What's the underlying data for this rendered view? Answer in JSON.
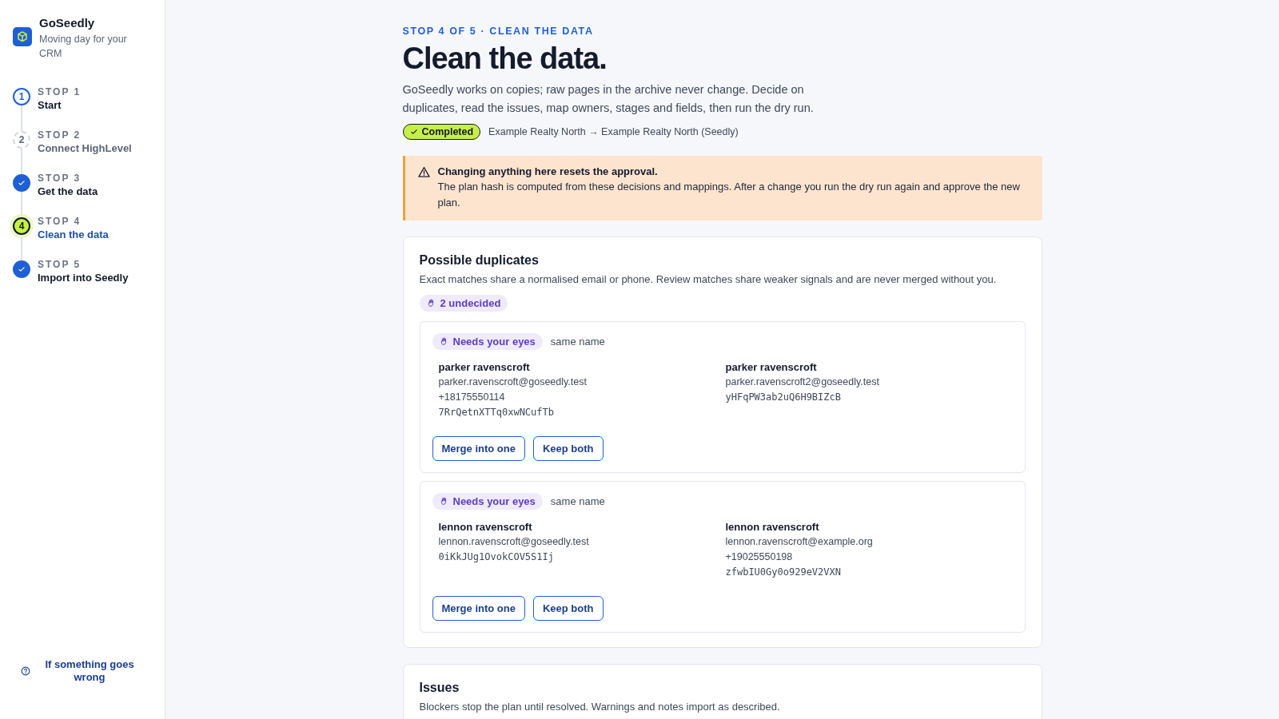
{
  "brand": {
    "name": "GoSeedly",
    "tagline": "Moving day for your CRM"
  },
  "steps": [
    {
      "label": "STOP 1",
      "title": "Start",
      "kind": "open",
      "number": "1"
    },
    {
      "label": "STOP 2",
      "title": "Connect HighLevel",
      "kind": "locked",
      "number": "2"
    },
    {
      "label": "STOP 3",
      "title": "Get the data",
      "kind": "done"
    },
    {
      "label": "STOP 4",
      "title": "Clean the data",
      "kind": "active",
      "number": "4"
    },
    {
      "label": "STOP 5",
      "title": "Import into Seedly",
      "kind": "done"
    }
  ],
  "help_link": "If something goes wrong",
  "eyebrow": "STOP 4 OF 5 · CLEAN THE DATA",
  "title": "Clean the data.",
  "intro": "GoSeedly works on copies; raw pages in the archive never change. Decide on duplicates, read the issues, map owners, stages and fields, then run the dry run.",
  "status_badge": "Completed",
  "route": "Example Realty North → Example Realty North (Seedly)",
  "warning": {
    "title": "Changing anything here resets the approval.",
    "text": "The plan hash is computed from these decisions and mappings. After a change you run the dry run again and approve the new plan."
  },
  "duplicates": {
    "title": "Possible duplicates",
    "text": "Exact matches share a normalised email or phone. Review matches share weaker signals and are never merged without you.",
    "count_badge": "2 undecided",
    "pairs": [
      {
        "badge": "Needs your eyes",
        "reason": "same name",
        "records": [
          {
            "name": "parker ravenscroft",
            "lines": [
              {
                "kind": "text",
                "value": "parker.ravenscroft@goseedly.test"
              },
              {
                "kind": "text",
                "value": "+18175550114"
              },
              {
                "kind": "mono",
                "value": "7RrQetnXTTq0xwNCufTb"
              }
            ]
          },
          {
            "name": "parker ravenscroft",
            "lines": [
              {
                "kind": "text",
                "value": "parker.ravenscroft2@goseedly.test"
              },
              {
                "kind": "mono",
                "value": "yHFqPW3ab2uQ6H9BIZcB"
              }
            ]
          }
        ],
        "buttons": [
          "Merge into one",
          "Keep both"
        ]
      },
      {
        "badge": "Needs your eyes",
        "reason": "same name",
        "records": [
          {
            "name": "lennon ravenscroft",
            "lines": [
              {
                "kind": "text",
                "value": "lennon.ravenscroft@goseedly.test"
              },
              {
                "kind": "mono",
                "value": "0iKkJUg1OvokCOV5S1Ij"
              }
            ]
          },
          {
            "name": "lennon ravenscroft",
            "lines": [
              {
                "kind": "text",
                "value": "lennon.ravenscroft@example.org"
              },
              {
                "kind": "text",
                "value": "+19025550198"
              },
              {
                "kind": "mono",
                "value": "zfwbIU0Gy0o929eV2VXN"
              }
            ]
          }
        ],
        "buttons": [
          "Merge into one",
          "Keep both"
        ]
      }
    ]
  },
  "issues": {
    "title": "Issues",
    "text": "Blockers stop the plan until resolved. Warnings and notes import as described."
  }
}
